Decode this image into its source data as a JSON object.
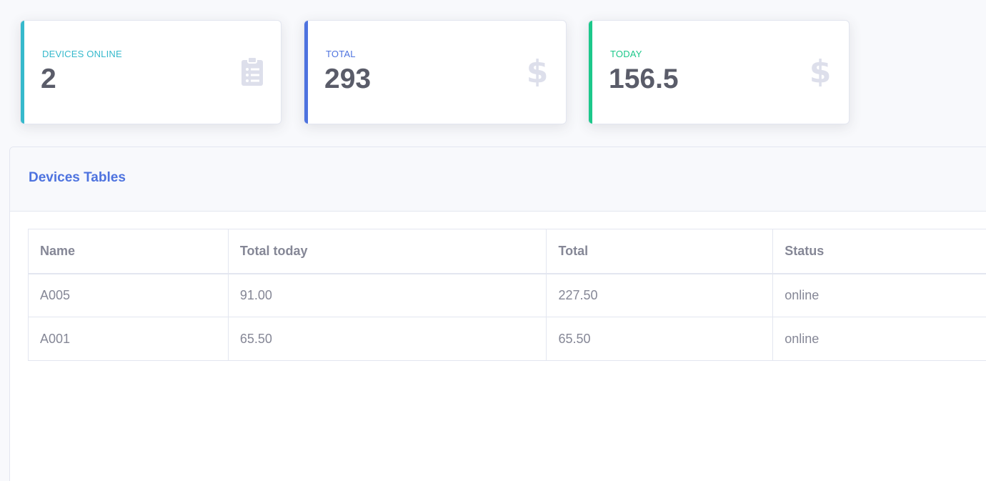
{
  "cards": [
    {
      "label": "DEVICES ONLINE",
      "value": "2",
      "accent": "#36b9cc",
      "icon": "clipboard-list-icon"
    },
    {
      "label": "TOTAL",
      "value": "293",
      "accent": "#4e73df",
      "icon": "dollar-sign-icon"
    },
    {
      "label": "TODAY",
      "value": "156.5",
      "accent": "#1cc88a",
      "icon": "dollar-sign-icon"
    }
  ],
  "table_panel": {
    "title": "Devices Tables",
    "headers": [
      "Name",
      "Total today",
      "Total",
      "Status"
    ],
    "rows": [
      [
        "A005",
        "91.00",
        "227.50",
        "online"
      ],
      [
        "A001",
        "65.50",
        "65.50",
        "online"
      ]
    ]
  },
  "colors": {
    "icon_gray": "#dddfeb",
    "text_dark": "#5a5c69",
    "text_muted": "#858796"
  }
}
